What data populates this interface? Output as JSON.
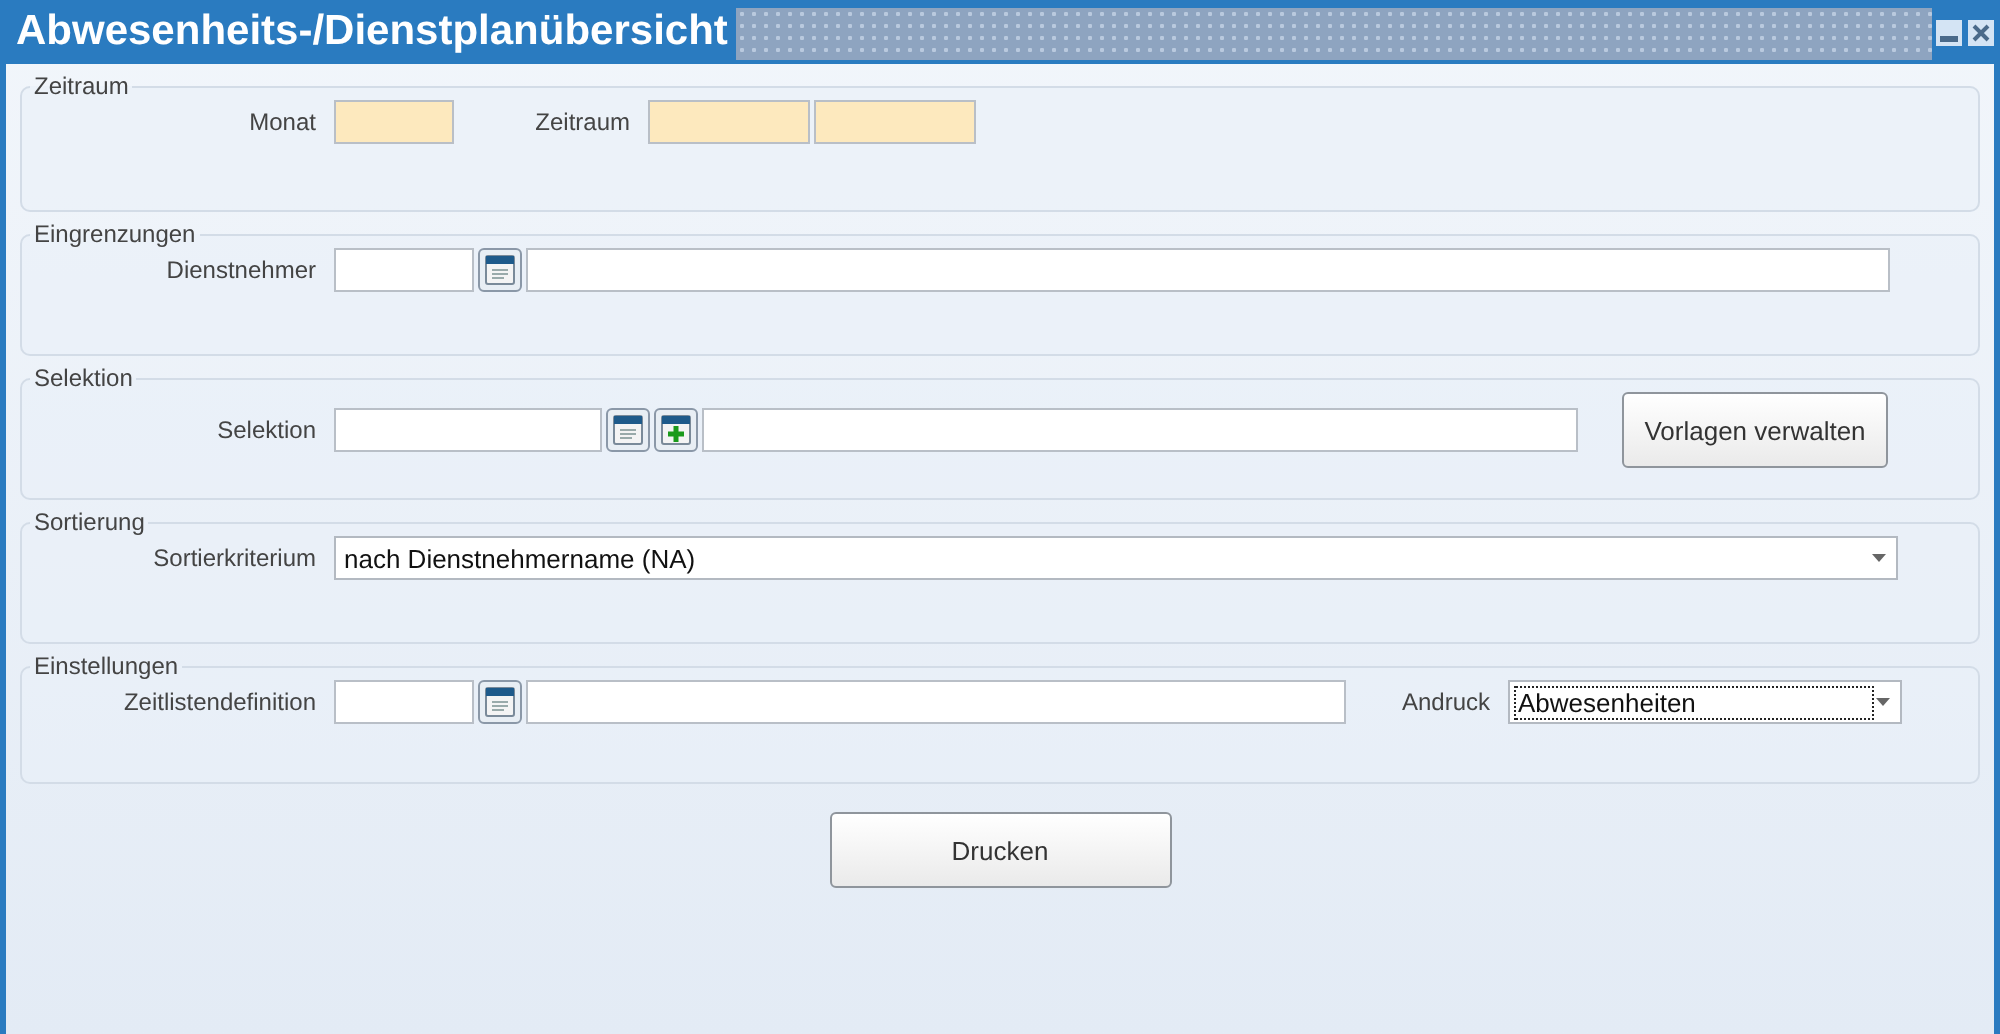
{
  "window": {
    "title": "Abwesenheits-/Dienstplanübersicht"
  },
  "zeitraum": {
    "title": "Zeitraum",
    "monat_label": "Monat",
    "zeitraum_label": "Zeitraum"
  },
  "eingrenzungen": {
    "title": "Eingrenzungen",
    "dienstnehmer_label": "Dienstnehmer"
  },
  "selektion": {
    "title": "Selektion",
    "selektion_label": "Selektion",
    "button": "Vorlagen verwalten"
  },
  "sortierung": {
    "title": "Sortierung",
    "kriterium_label": "Sortierkriterium",
    "kriterium_value": "nach Dienstnehmername (NA)"
  },
  "einstellungen": {
    "title": "Einstellungen",
    "zeitliste_label": "Zeitlistendefinition",
    "andruck_label": "Andruck",
    "andruck_value": "Abwesenheiten",
    "andruck_focused": true
  },
  "print_button": "Drucken"
}
